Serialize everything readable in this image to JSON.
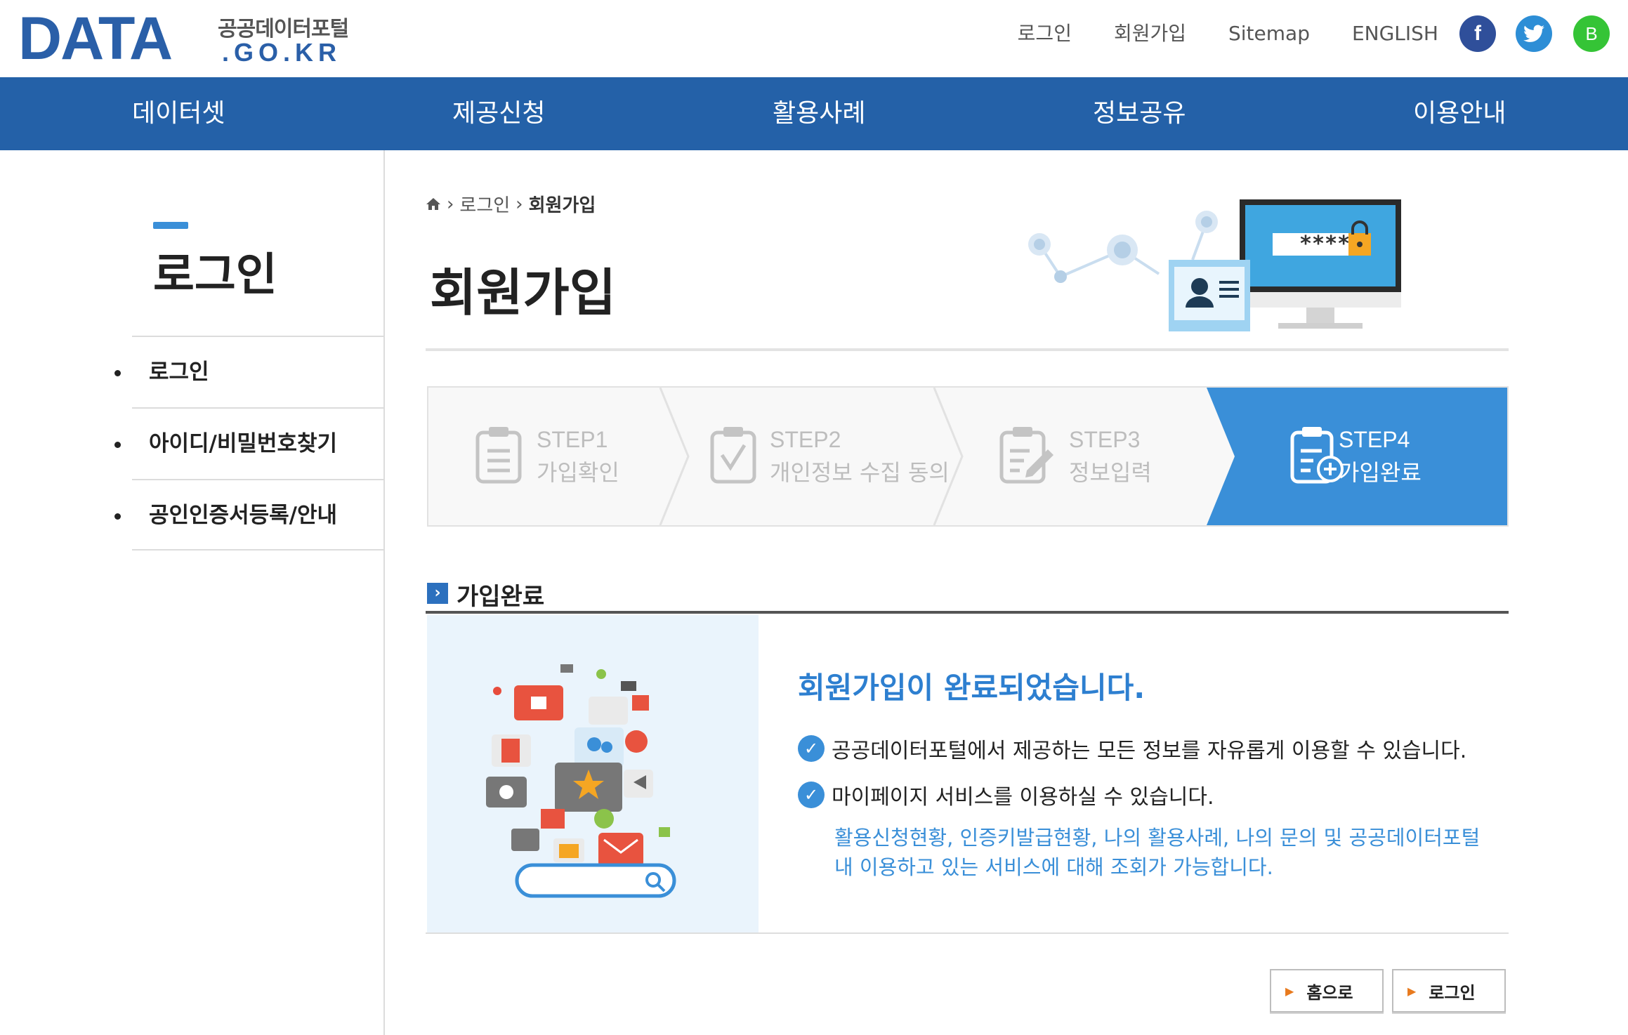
{
  "logo": {
    "main": "DATA",
    "sub": "공공데이터포털",
    "domain": ".GO.KR"
  },
  "util_links": [
    "로그인",
    "회원가입",
    "Sitemap",
    "ENGLISH"
  ],
  "social": {
    "facebook": "f",
    "twitter": "twitter-bird-icon",
    "blog": "B"
  },
  "gnb": [
    "데이터셋",
    "제공신청",
    "활용사례",
    "정보공유",
    "이용안내"
  ],
  "sidebar": {
    "title": "로그인",
    "items": [
      {
        "label": "로그인"
      },
      {
        "label": "아이디/비밀번호찾기"
      },
      {
        "label": "공인인증서등록/안내"
      }
    ]
  },
  "breadcrumb": {
    "home_icon": "home-icon",
    "items": [
      "로그인",
      "회원가입"
    ]
  },
  "page_title": "회원가입",
  "hero": {
    "password_mask": "****"
  },
  "steps": [
    {
      "label": "STEP1",
      "sub": "가입확인",
      "active": false
    },
    {
      "label": "STEP2",
      "sub": "개인정보 수집 동의",
      "active": false
    },
    {
      "label": "STEP3",
      "sub": "정보입력",
      "active": false
    },
    {
      "label": "STEP4",
      "sub": "가입완료",
      "active": true
    }
  ],
  "section": {
    "title": "가입완료"
  },
  "complete": {
    "title": "회원가입이 완료되었습니다.",
    "points": [
      "공공데이터포털에서 제공하는 모든 정보를 자유롭게 이용할 수 있습니다.",
      "마이페이지 서비스를 이용하실 수 있습니다."
    ],
    "note": "활용신청현황, 인증키발급현황, 나의 활용사례, 나의 문의 및 공공데이터포털 내 이용하고 있는 서비스에 대해 조회가 가능합니다."
  },
  "buttons": {
    "home": "홈으로",
    "login": "로그인"
  },
  "colors": {
    "brand_blue": "#2461a8",
    "accent_blue": "#3a8fd8",
    "active_step": "#3a8fd8",
    "arrow_orange": "#e87a1e"
  }
}
